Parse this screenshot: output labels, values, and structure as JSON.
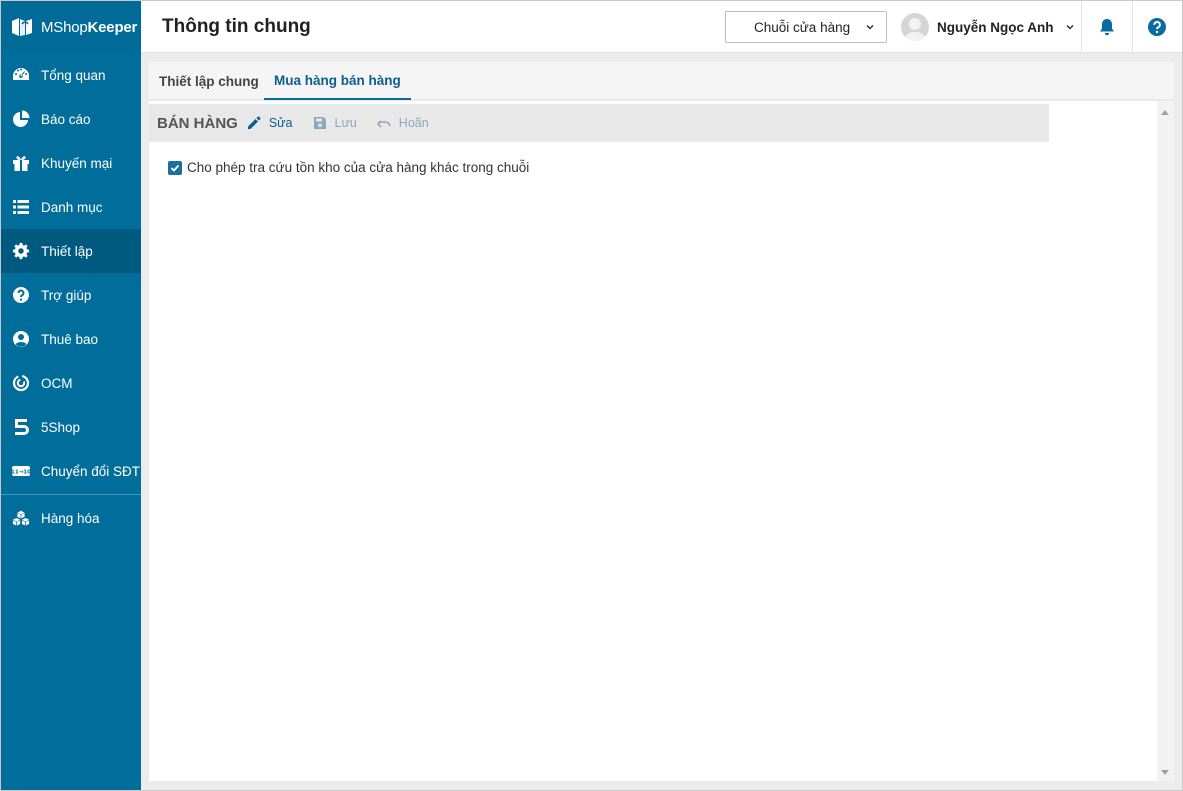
{
  "app": {
    "logo_prefix": "MShop",
    "logo_suffix": "Keeper",
    "accent_color": "#006d9b",
    "active_color": "#005a80"
  },
  "sidebar": {
    "items": [
      {
        "label": "Tổng quan",
        "icon": "dashboard-icon"
      },
      {
        "label": "Báo cáo",
        "icon": "pie-chart-icon"
      },
      {
        "label": "Khuyến mại",
        "icon": "gift-icon"
      },
      {
        "label": "Danh mục",
        "icon": "list-icon"
      },
      {
        "label": "Thiết lập",
        "icon": "gear-icon",
        "active": true
      },
      {
        "label": "Trợ giúp",
        "icon": "question-icon"
      },
      {
        "label": "Thuê bao",
        "icon": "user-circle-icon"
      },
      {
        "label": "OCM",
        "icon": "ocm-icon"
      },
      {
        "label": "5Shop",
        "icon": "5shop-icon"
      },
      {
        "label": "Chuyển đổi SĐT",
        "icon": "phone-convert-icon"
      },
      {
        "label": "Hàng hóa",
        "icon": "boxes-icon"
      }
    ]
  },
  "header": {
    "title": "Thông tin chung",
    "store_selector": "Chuỗi cửa hàng",
    "user_name": "Nguyễn Ngọc Anh"
  },
  "tabs": [
    {
      "label": "Thiết lập chung",
      "active": false
    },
    {
      "label": "Mua hàng bán hàng",
      "active": true
    }
  ],
  "section": {
    "title": "BÁN HÀNG",
    "edit_label": "Sửa",
    "save_label": "Lưu",
    "cancel_label": "Hoãn"
  },
  "options": [
    {
      "label": "Cho phép tra cứu tồn kho của cửa hàng khác trong chuỗi",
      "checked": true
    }
  ]
}
